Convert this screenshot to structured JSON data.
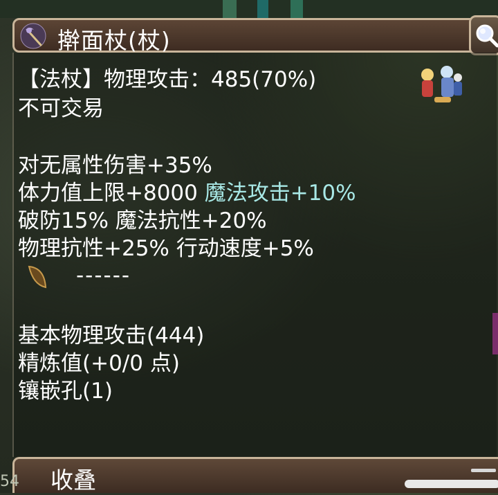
{
  "item": {
    "title": "擀面杖(杖)"
  },
  "stats": {
    "line1_prefix": "【法杖】物理攻击：",
    "line1_value": "485(70%)",
    "trade": "不可交易",
    "line3": "对无属性伤害+35%",
    "line4_a": "体力值上限+8000",
    "line4_b": "魔法攻击+10%",
    "line5": "破防15% 魔法抗性+20%",
    "line6": "物理抗性+25% 行动速度+5%",
    "dashes": "------",
    "base_attack": "基本物理攻击(444)",
    "refine": "精炼值(+0/0 点)",
    "slots": "镶嵌孔(1)"
  },
  "footer": {
    "collapse_label": "收叠",
    "edge_number": "54"
  },
  "colors": {
    "highlight": "#a8e8e6",
    "frame": "#c9b59a"
  },
  "icons": [
    "staff-icon",
    "magnify-icon",
    "seed-icon"
  ]
}
